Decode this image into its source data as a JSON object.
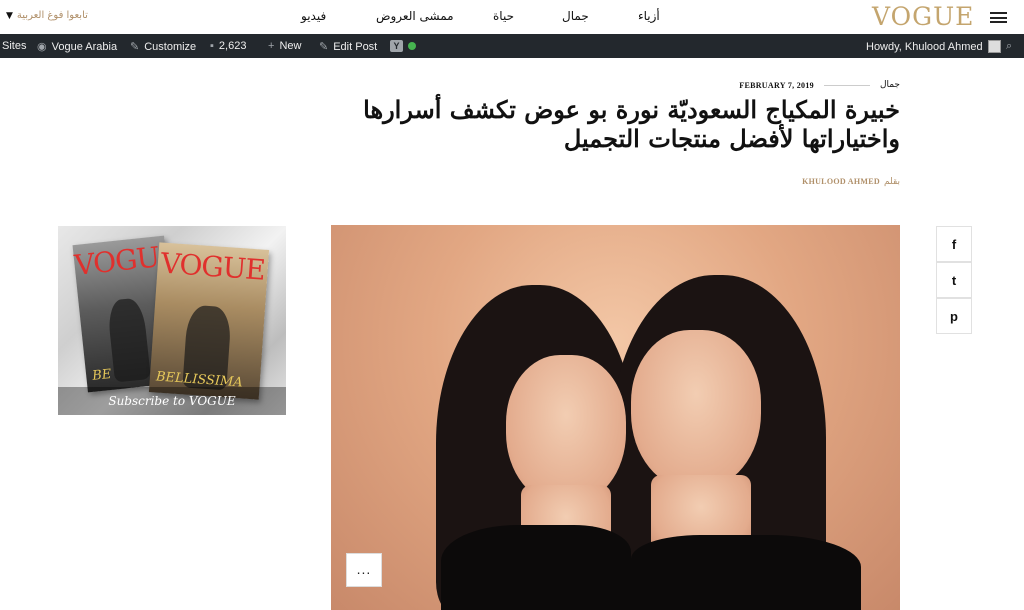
{
  "topnav": {
    "language_label": "تابعوا فوغ العربية",
    "nav_items": [
      "أزياء",
      "جمال",
      "حياة",
      "ممشى العروض",
      "فيديو"
    ],
    "logo": "VOGUE"
  },
  "adminbar": {
    "sites": "Sites",
    "site_name": "Vogue Arabia",
    "customize": "Customize",
    "comments_count": "2,623",
    "new": "New",
    "edit_post": "Edit Post",
    "howdy": "Howdy, Khulood Ahmed"
  },
  "article": {
    "category": "جمال",
    "date": "FEBRUARY 7, 2019",
    "title": "خبيرة المكياج السعوديّة نورة بو عوض تكشف أسرارها واختياراتها لأفضل منتجات التجميل",
    "byline_prefix": "بقلم",
    "author": "KHULOOD AHMED"
  },
  "ad": {
    "cover1_title": "VOGUE",
    "cover1_bottom": "BE",
    "cover2_title": "VOGUE",
    "cover2_bottom": "BELLISSIMA",
    "subscribe_text": "Subscribe to VOGUE"
  },
  "hero": {
    "more_label": "..."
  },
  "share": {
    "facebook": "f",
    "twitter": "t",
    "pinterest": "p"
  },
  "colors": {
    "gold": "#c4a56e",
    "adminbar_bg": "#23282d",
    "status_dot": "#46b450"
  }
}
